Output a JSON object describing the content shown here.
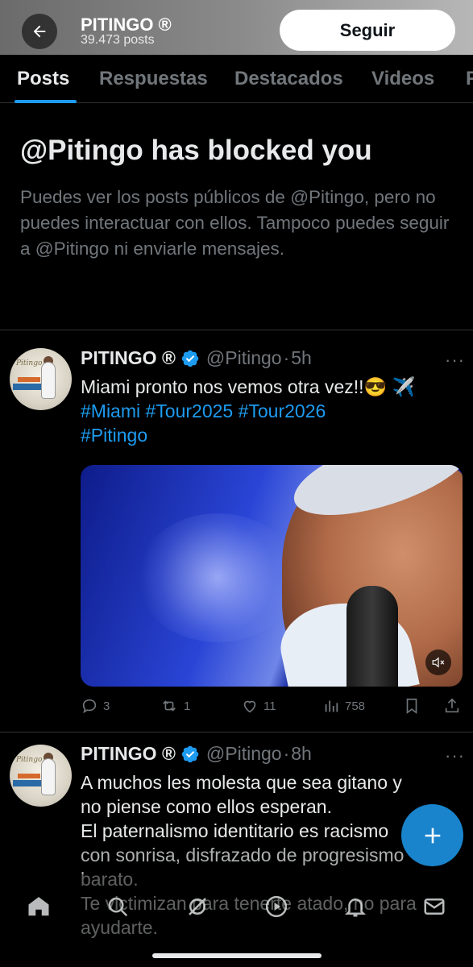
{
  "header": {
    "title": "PITINGO ®",
    "post_count": "39.473 posts",
    "follow_label": "Seguir"
  },
  "tabs": [
    {
      "label": "Posts",
      "active": true
    },
    {
      "label": "Respuestas",
      "active": false
    },
    {
      "label": "Destacados",
      "active": false
    },
    {
      "label": "Videos",
      "active": false
    },
    {
      "label": "F",
      "active": false
    }
  ],
  "blocked": {
    "title": "@Pitingo has blocked you",
    "description": "Puedes ver los posts públicos de @Pitingo, pero no puedes interactuar con ellos. Tampoco puedes seguir a @Pitingo ni enviarle mensajes."
  },
  "posts": [
    {
      "name": "PITINGO ®",
      "handle": "@Pitingo",
      "time": "5h",
      "text_line1": "Miami pronto nos vemos otra vez!!😎 ✈️",
      "hashtags_line1": "#Miami #Tour2025 #Tour2026",
      "hashtags_line2": "#Pitingo",
      "stats": {
        "replies": "3",
        "reposts": "1",
        "likes": "11",
        "views": "758"
      },
      "has_video": true
    },
    {
      "name": "PITINGO ®",
      "handle": "@Pitingo",
      "time": "8h",
      "lines": [
        "A muchos les molesta que sea gitano y",
        "no piense como ellos esperan.",
        "El paternalismo identitario es racismo",
        "con sonrisa, disfrazado de progresismo",
        "barato.",
        "Te victimizan para tenerte atado, no para",
        "ayudarte."
      ]
    }
  ],
  "icons": {
    "back": "back-arrow-icon",
    "verified": "verified-badge-icon",
    "more": "more-icon",
    "mute": "mute-icon",
    "reply": "reply-icon",
    "repost": "repost-icon",
    "like": "like-icon",
    "views": "views-icon",
    "bookmark": "bookmark-icon",
    "share": "share-icon",
    "compose": "compose-plus-icon",
    "home": "home-icon",
    "search": "search-icon",
    "grok": "grok-icon",
    "video": "video-icon",
    "notifications": "notifications-icon",
    "messages": "messages-icon"
  },
  "colors": {
    "accent": "#1d9bf0",
    "text_primary": "#e7e9ea",
    "text_secondary": "#71767b",
    "background": "#000000"
  },
  "avatar_text": "Pitingo"
}
